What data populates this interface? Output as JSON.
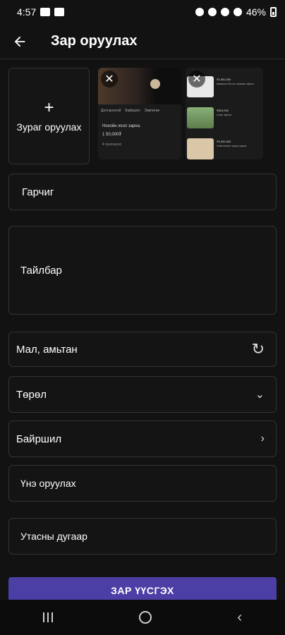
{
  "status_bar": {
    "time": "4:57",
    "battery": "46%"
  },
  "app_bar": {
    "title": "Зар оруулах"
  },
  "gallery": {
    "add_photo_label": "Зураг оруулах",
    "add_icon": "+",
    "close_icon": "✕",
    "thumb1": {
      "tab_labels": [
        "Дэлгэрэнгүй",
        "Байршил",
        "Зөвлөгөө"
      ],
      "title": "Нохойн хоол зарна.",
      "price": "1 50,000₮",
      "footer": "4 хүнсэнээс"
    },
    "thumb2": {
      "items": [
        {
          "price": "₮2,500,000",
          "title": "ямааны ботгоо манаж зарна"
        },
        {
          "price": "₮820,000",
          "title": "Хонь зарна"
        },
        {
          "price": "₮3,000,000",
          "title": "Хойлонгын зарж зарна"
        }
      ]
    }
  },
  "form": {
    "title_field": "Гарчиг",
    "description_field": "Тайлбар",
    "category_value": "Мал, амьтан",
    "type_field": "Төрөл",
    "location_field": "Байршил",
    "price_field": "Үнэ оруулах",
    "phone_field": "Утасны дугаар"
  },
  "submit_label": "ЗАР ҮҮСГЭХ",
  "colors": {
    "accent": "#4b3fa6",
    "refresh": "#3fbf6a",
    "background": "#121212"
  }
}
